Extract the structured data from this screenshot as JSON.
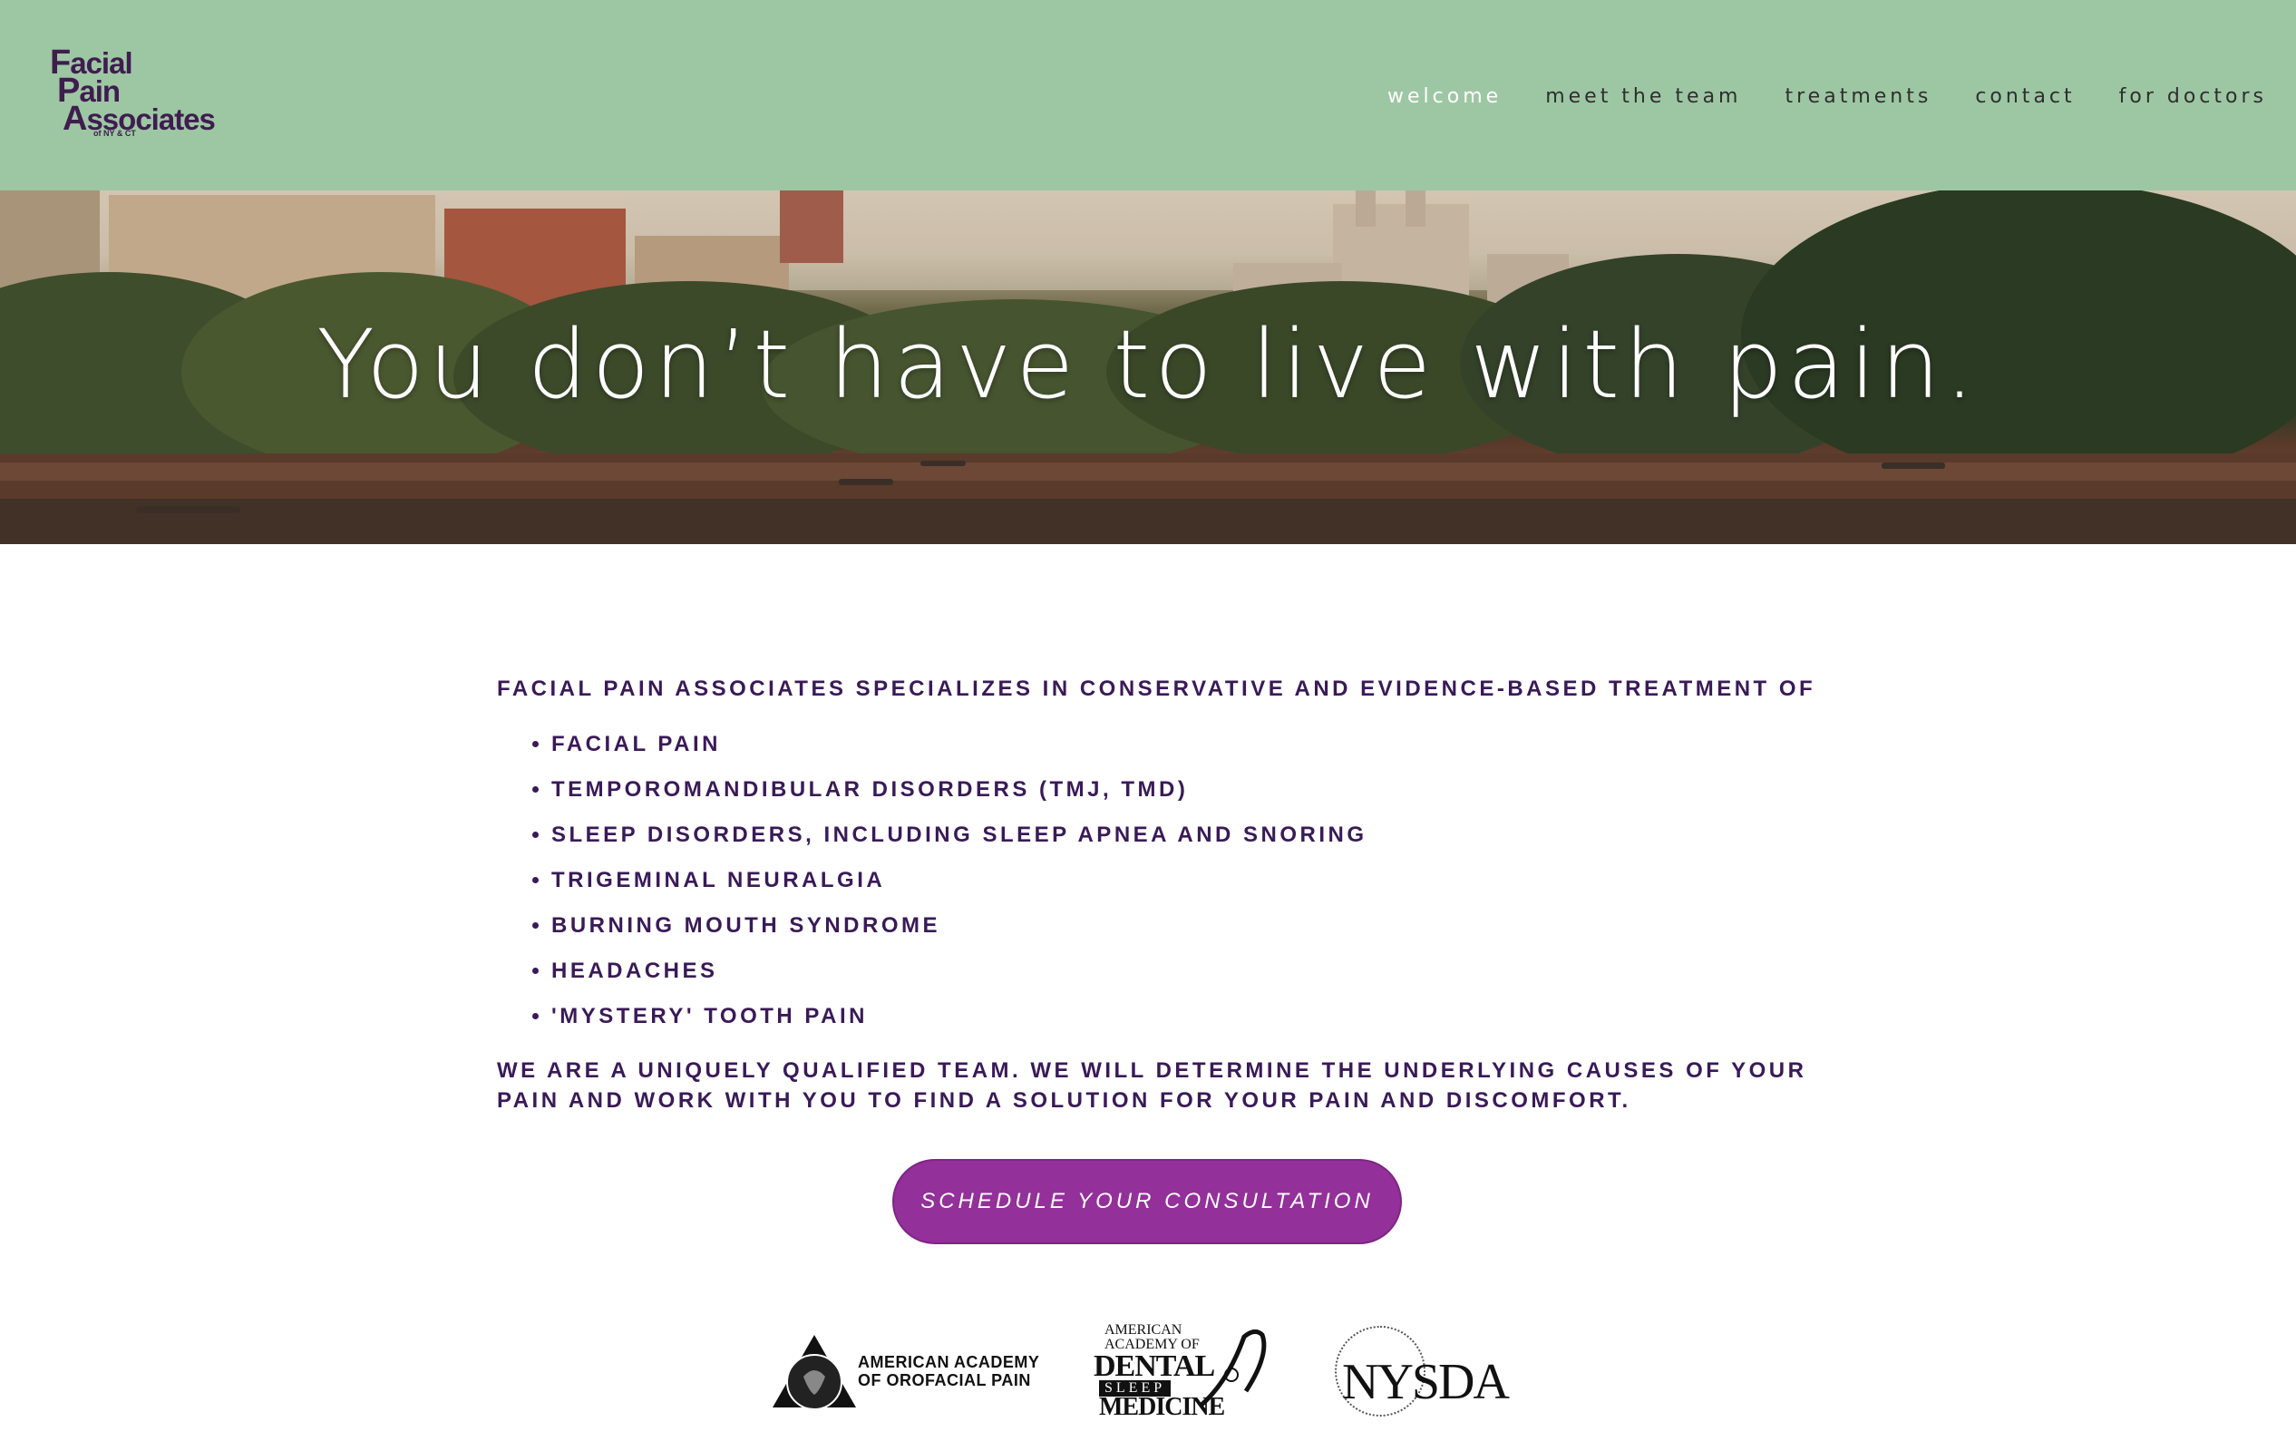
{
  "header": {
    "logo": {
      "line1_initial": "F",
      "line1_rest": "acial",
      "line2_initial": "P",
      "line2_rest": "ain",
      "line3_initial": "A",
      "line3_rest": "ssociates",
      "sub": "of NY & CT"
    },
    "nav": [
      {
        "label": "welcome",
        "active": true
      },
      {
        "label": "meet the team",
        "active": false
      },
      {
        "label": "treatments",
        "active": false
      },
      {
        "label": "contact",
        "active": false
      },
      {
        "label": "for doctors",
        "active": false
      }
    ]
  },
  "hero": {
    "title": "You don’t have to live with pain."
  },
  "main": {
    "intro": "FACIAL PAIN ASSOCIATES SPECIALIZES IN CONSERVATIVE AND EVIDENCE-BASED TREATMENT OF",
    "conditions": [
      "FACIAL PAIN",
      "TEMPOROMANDIBULAR DISORDERS (TMJ, TMD)",
      "SLEEP DISORDERS, INCLUDING SLEEP APNEA AND SNORING",
      "TRIGEMINAL NEURALGIA",
      "BURNING MOUTH SYNDROME",
      "HEADACHES",
      "'MYSTERY' TOOTH PAIN"
    ],
    "closing": "WE ARE A UNIQUELY QUALIFIED TEAM. WE WILL DETERMINE THE UNDERLYING CAUSES OF YOUR PAIN AND WORK WITH YOU TO FIND A SOLUTION FOR YOUR PAIN AND DISCOMFORT.",
    "cta_label": "SCHEDULE YOUR CONSULTATION"
  },
  "partners": {
    "aaop": {
      "line1": "AMERICAN ACADEMY",
      "line2": "OF OROFACIAL PAIN"
    },
    "aadsm": {
      "american": "AMERICAN",
      "academy": "ACADEMY OF",
      "dental": "DENTAL",
      "sleep": "SLEEP",
      "medicine": "MEDICINE"
    },
    "nysda": {
      "name": "NYSDA",
      "ring": "NEW YORK STATE DENTAL ASSOCIATION"
    }
  },
  "colors": {
    "header_bg": "#9dc7a3",
    "brand_purple": "#3a1a58",
    "cta_bg": "#93309a"
  }
}
